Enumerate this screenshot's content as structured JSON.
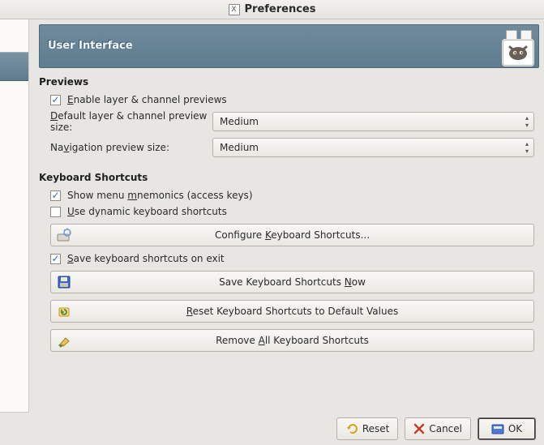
{
  "window": {
    "title": "Preferences"
  },
  "banner": {
    "title": "User Interface"
  },
  "previews": {
    "heading": "Previews",
    "enable_label_pre": "E",
    "enable_label_post": "nable layer & channel previews",
    "enable_checked": true,
    "default_size_pre": "D",
    "default_size_post": "efault layer & channel preview size:",
    "default_size_value": "Medium",
    "nav_size_pre": "Na",
    "nav_size_mid": "v",
    "nav_size_post": "igation preview size:",
    "nav_size_value": "Medium"
  },
  "shortcuts": {
    "heading": "Keyboard Shortcuts",
    "mnemonics_pre": "Show menu ",
    "mnemonics_mid": "m",
    "mnemonics_post": "nemonics (access keys)",
    "mnemonics_checked": true,
    "dynamic_pre": "U",
    "dynamic_post": "se dynamic keyboard shortcuts",
    "dynamic_checked": false,
    "configure_pre": "Configure ",
    "configure_mid": "K",
    "configure_post": "eyboard Shortcuts...",
    "save_exit_pre": "S",
    "save_exit_post": "ave keyboard shortcuts on exit",
    "save_exit_checked": true,
    "save_now_pre": "Save Keyboard Shortcuts ",
    "save_now_mid": "N",
    "save_now_post": "ow",
    "reset_pre": "R",
    "reset_post": "eset Keyboard Shortcuts to Default Values",
    "remove_pre": "Remove ",
    "remove_mid": "A",
    "remove_post": "ll Keyboard Shortcuts"
  },
  "footer": {
    "reset": "Reset",
    "cancel": "Cancel",
    "ok": "OK"
  }
}
